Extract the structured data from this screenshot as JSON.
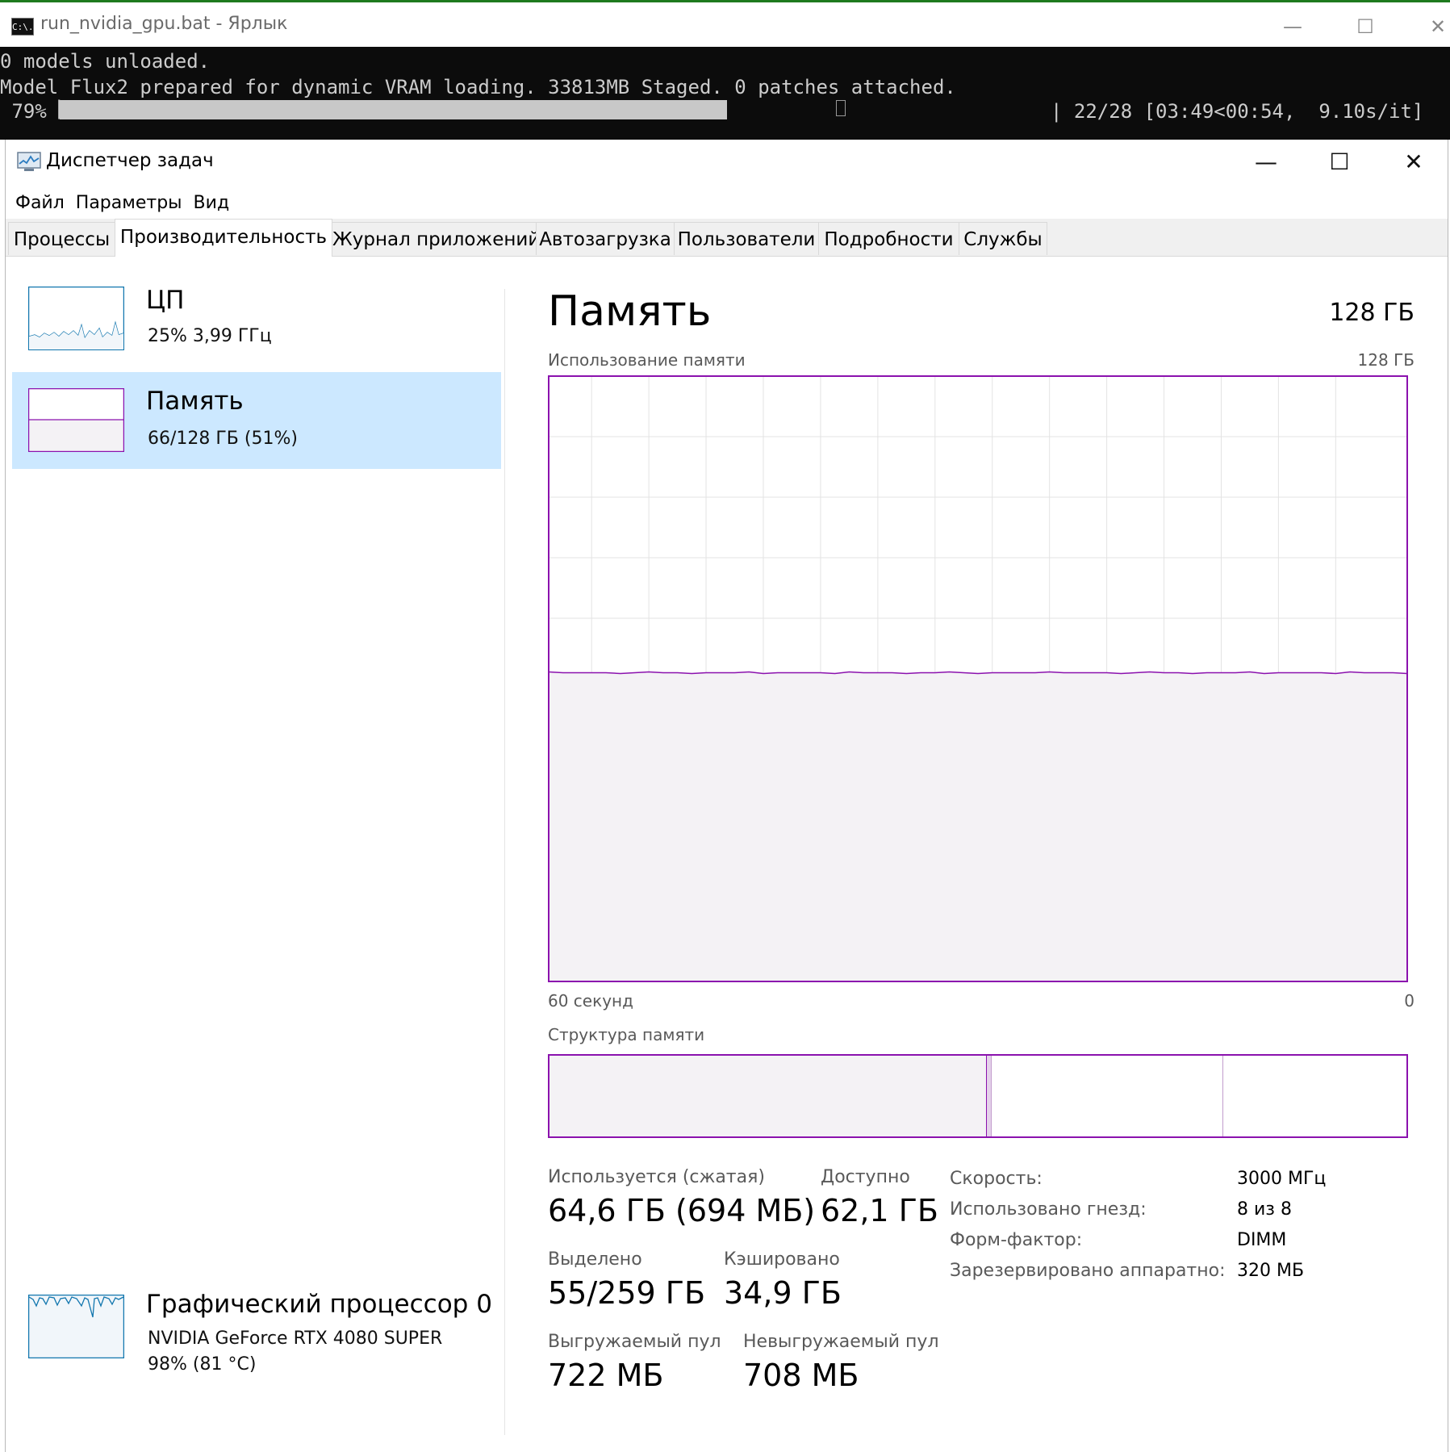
{
  "console": {
    "title": "run_nvidia_gpu.bat - Ярлык",
    "icon": "C:\\.",
    "line1": "0 models unloaded.",
    "line2": "Model Flux2 prepared for dynamic VRAM loading. 33813MB Staged. 0 patches attached.",
    "percent": " 79%",
    "progress_fraction": 0.79,
    "progress_stats": "| 22/28 [03:49<00:54,  9.10s/it]",
    "minimize": "—",
    "maximize": "☐",
    "close": "✕"
  },
  "taskmanager": {
    "title": "Диспетчер задач",
    "minimize": "—",
    "maximize": "☐",
    "close": "✕",
    "menu": [
      "Файл",
      "Параметры",
      "Вид"
    ],
    "tabs": [
      "Процессы",
      "Производительность",
      "Журнал приложений",
      "Автозагрузка",
      "Пользователи",
      "Подробности",
      "Службы"
    ],
    "active_tab": "Производительность",
    "sidebar": [
      {
        "name": "ЦП",
        "sub": "25%  3,99 ГГц",
        "selected": false
      },
      {
        "name": "Память",
        "sub": "66/128 ГБ (51%)",
        "selected": true
      },
      {
        "name": "Графический процессор 0",
        "sub": "NVIDIA GeForce RTX 4080 SUPER",
        "sub2": "98%  (81 °C)",
        "selected": false
      }
    ],
    "memory": {
      "title": "Память",
      "total": "128 ГБ",
      "usage_label": "Использование памяти",
      "usage_max": "128 ГБ",
      "usage_fraction": 0.51,
      "axis_left": "60 секунд",
      "axis_right": "0",
      "structure_label": "Структура памяти",
      "structure": {
        "in_use_fraction": 0.51,
        "modified_fraction": 0.006,
        "standby_fraction": 0.27,
        "free_fraction": 0.214
      },
      "stats": {
        "in_use_label": "Используется (сжатая)",
        "in_use_value": "64,6 ГБ (694 МБ)",
        "available_label": "Доступно",
        "available_value": "62,1 ГБ",
        "committed_label": "Выделено",
        "committed_value": "55/259 ГБ",
        "cached_label": "Кэшировано",
        "cached_value": "34,9 ГБ",
        "paged_label": "Выгружаемый пул",
        "paged_value": "722 МБ",
        "nonpaged_label": "Невыгружаемый пул",
        "nonpaged_value": "708 МБ"
      },
      "details": [
        {
          "label": "Скорость:",
          "value": "3000 МГц"
        },
        {
          "label": "Использовано гнезд:",
          "value": "8 из 8"
        },
        {
          "label": "Форм-фактор:",
          "value": "DIMM"
        },
        {
          "label": "Зарезервировано аппаратно:",
          "value": "320 МБ"
        }
      ]
    },
    "colors": {
      "memory_accent": "#8b12ae",
      "memory_fill": "#f4f2f5",
      "cpu_accent": "#1176ae",
      "gpu_fill": "#f1f6fa",
      "selected_bg": "#cce8ff"
    }
  }
}
